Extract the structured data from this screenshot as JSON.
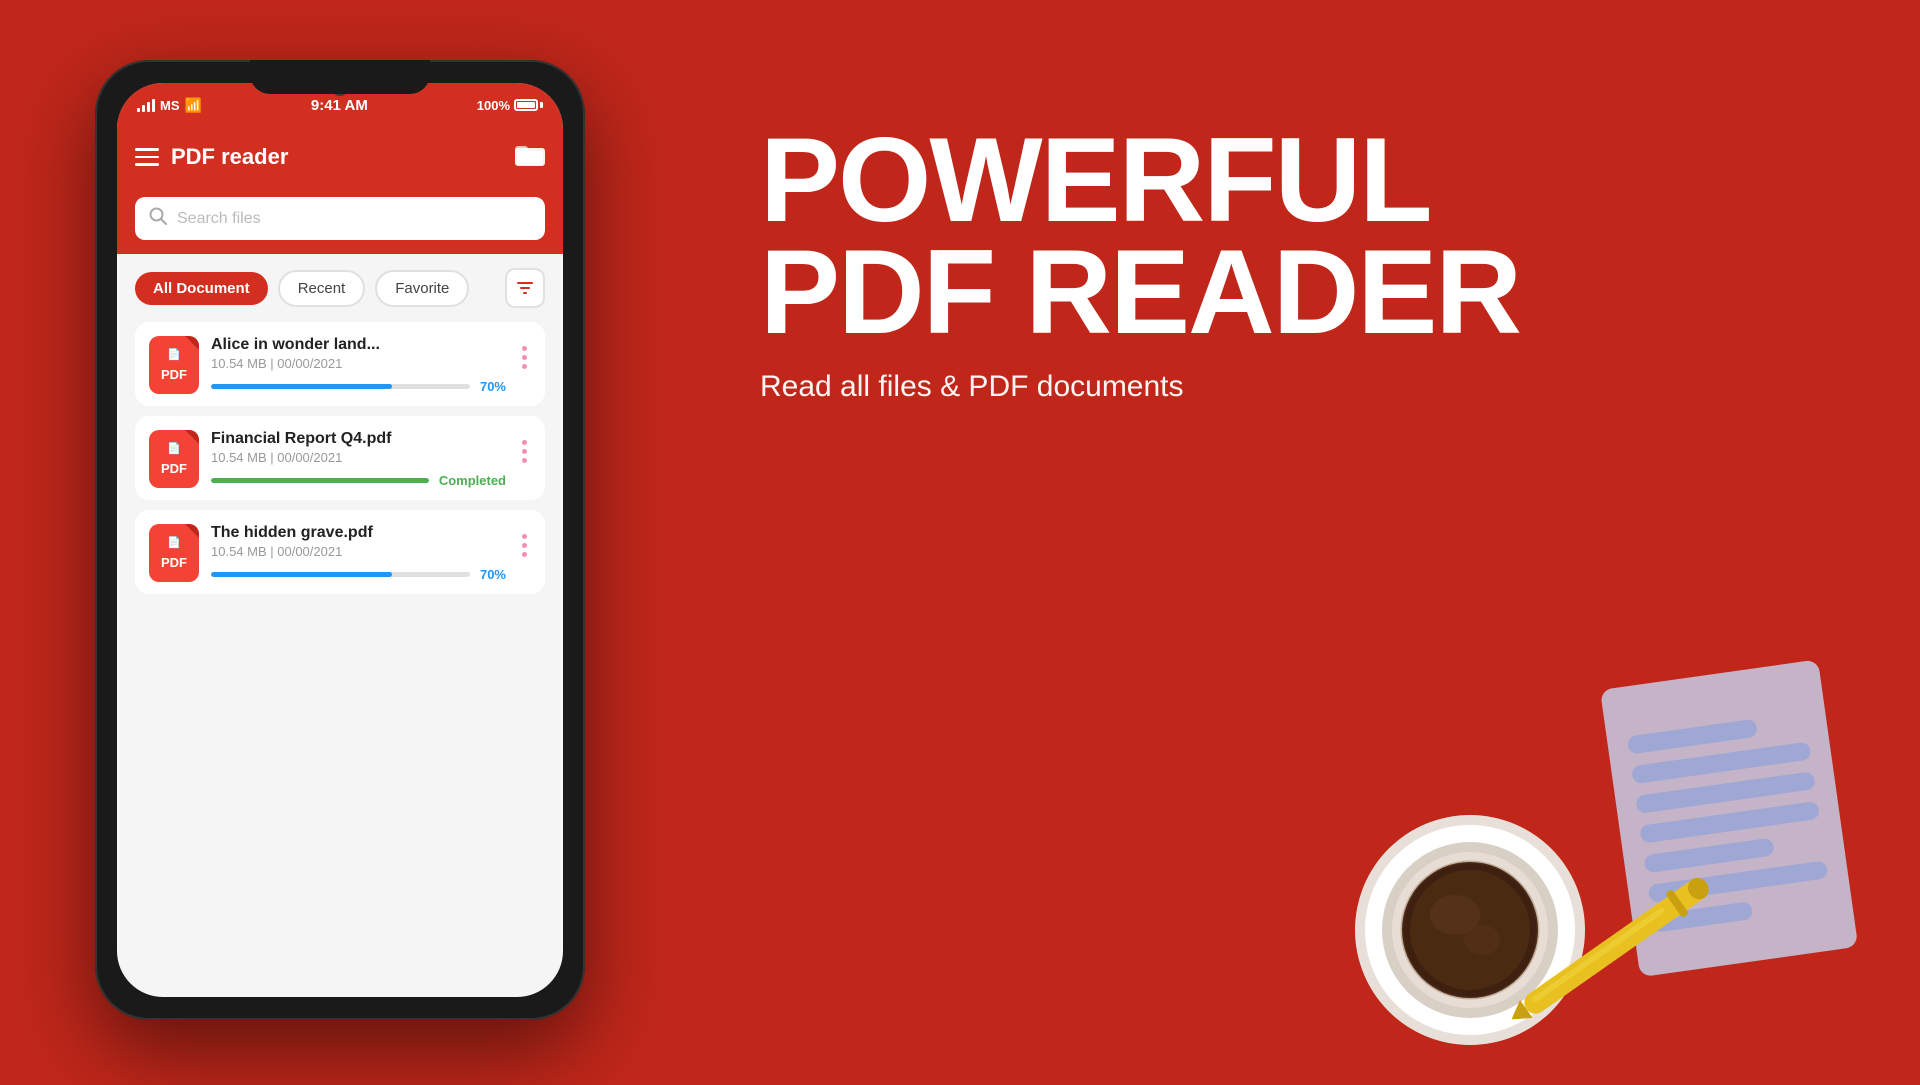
{
  "background_color": "#c0271a",
  "status_bar": {
    "carrier": "MS",
    "time": "9:41 AM",
    "battery": "100%"
  },
  "app_header": {
    "title": "PDF reader",
    "menu_icon": "hamburger",
    "action_icon": "folder"
  },
  "search": {
    "placeholder": "Search files"
  },
  "tabs": [
    {
      "label": "All Document",
      "active": true
    },
    {
      "label": "Recent",
      "active": false
    },
    {
      "label": "Favorite",
      "active": false
    }
  ],
  "files": [
    {
      "name": "Alice in wonder land...",
      "meta": "10.54 MB | 00/00/2021",
      "progress": 70,
      "progress_label": "70%",
      "progress_type": "blue",
      "status": "in_progress"
    },
    {
      "name": "Financial Report Q4.pdf",
      "meta": "10.54 MB | 00/00/2021",
      "progress": 100,
      "progress_label": "Completed",
      "progress_type": "green",
      "status": "completed"
    },
    {
      "name": "The hidden grave.pdf",
      "meta": "10.54 MB | 00/00/2021",
      "progress": 70,
      "progress_label": "70%",
      "progress_type": "blue",
      "status": "in_progress"
    }
  ],
  "hero": {
    "line1": "POWERFUL",
    "line2": "PDF READER",
    "subtitle": "Read all files & PDF documents"
  },
  "colors": {
    "brand_red": "#d32f20",
    "background": "#c0271a",
    "progress_blue": "#2196f3",
    "progress_green": "#4caf50"
  }
}
